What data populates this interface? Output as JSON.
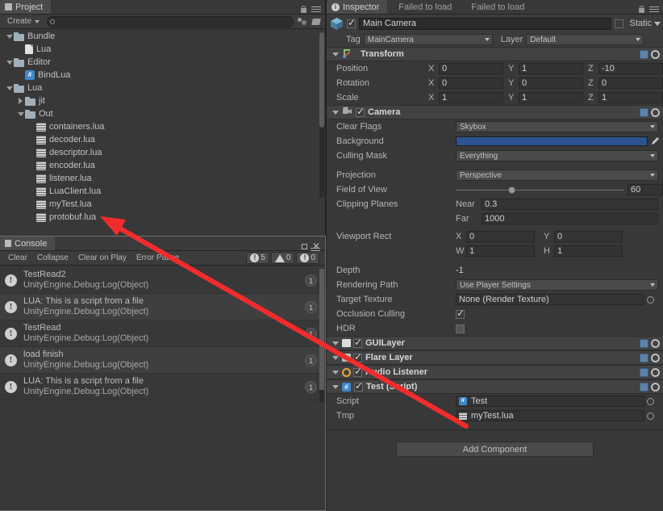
{
  "project": {
    "tab_label": "Project",
    "create_label": "Create",
    "search_placeholder": "",
    "icons": {
      "lock": "lock-icon",
      "menu": "hamburger-menu-icon",
      "favorite": "favorite-icon",
      "label": "label-icon",
      "search": "search-icon"
    },
    "tree": [
      {
        "label": "Bundle",
        "indent": 0,
        "twisty": "down",
        "icon": "folder"
      },
      {
        "label": "Lua",
        "indent": 1,
        "twisty": "none",
        "icon": "doc"
      },
      {
        "label": "Editor",
        "indent": 0,
        "twisty": "down",
        "icon": "folder"
      },
      {
        "label": "BindLua",
        "indent": 1,
        "twisty": "none",
        "icon": "script"
      },
      {
        "label": "Lua",
        "indent": 0,
        "twisty": "down",
        "icon": "folder"
      },
      {
        "label": "jit",
        "indent": 1,
        "twisty": "right",
        "icon": "folder"
      },
      {
        "label": "Out",
        "indent": 1,
        "twisty": "down",
        "icon": "folder"
      },
      {
        "label": "containers.lua",
        "indent": 2,
        "twisty": "none",
        "icon": "lua"
      },
      {
        "label": "decoder.lua",
        "indent": 2,
        "twisty": "none",
        "icon": "lua"
      },
      {
        "label": "descriptor.lua",
        "indent": 2,
        "twisty": "none",
        "icon": "lua"
      },
      {
        "label": "encoder.lua",
        "indent": 2,
        "twisty": "none",
        "icon": "lua"
      },
      {
        "label": "listener.lua",
        "indent": 2,
        "twisty": "none",
        "icon": "lua"
      },
      {
        "label": "LuaClient.lua",
        "indent": 2,
        "twisty": "none",
        "icon": "lua"
      },
      {
        "label": "myTest.lua",
        "indent": 2,
        "twisty": "none",
        "icon": "lua"
      },
      {
        "label": "protobuf.lua",
        "indent": 2,
        "twisty": "none",
        "icon": "lua"
      }
    ]
  },
  "console": {
    "tab_label": "Console",
    "buttons": [
      "Clear",
      "Collapse",
      "Clear on Play",
      "Error Pause"
    ],
    "counts": {
      "info": "5",
      "warning": "0",
      "error": "0"
    },
    "window_buttons": {
      "maximize": "maximize-icon",
      "close": "close-icon",
      "menu": "hamburger-menu-icon"
    },
    "entries": [
      {
        "message": "TestRead2",
        "stack": "UnityEngine.Debug:Log(Object)",
        "count": "1"
      },
      {
        "message": "LUA: This is a script from a file",
        "stack": "UnityEngine.Debug:Log(Object)",
        "count": "1"
      },
      {
        "message": "TestRead",
        "stack": "UnityEngine.Debug:Log(Object)",
        "count": "1"
      },
      {
        "message": "load finish",
        "stack": "UnityEngine.Debug:Log(Object)",
        "count": "1"
      },
      {
        "message": "LUA: This is a script from a file",
        "stack": "UnityEngine.Debug:Log(Object)",
        "count": "1"
      }
    ]
  },
  "inspector": {
    "tabs": [
      {
        "label": "Inspector",
        "active": true
      },
      {
        "label": "Failed to load",
        "active": false
      },
      {
        "label": "Failed to load",
        "active": false
      }
    ],
    "game_object": {
      "name": "Main Camera",
      "enabled": true,
      "static_label": "Static",
      "tag_label": "Tag",
      "tag_value": "MainCamera",
      "layer_label": "Layer",
      "layer_value": "Default"
    },
    "transform": {
      "title": "Transform",
      "rows": [
        {
          "label": "Position",
          "x": "0",
          "y": "1",
          "z": "-10"
        },
        {
          "label": "Rotation",
          "x": "0",
          "y": "0",
          "z": "0"
        },
        {
          "label": "Scale",
          "x": "1",
          "y": "1",
          "z": "1"
        }
      ]
    },
    "camera": {
      "title": "Camera",
      "enabled": true,
      "clear_flags_label": "Clear Flags",
      "clear_flags_value": "Skybox",
      "background_label": "Background",
      "background_color": "#2c5291",
      "culling_mask_label": "Culling Mask",
      "culling_mask_value": "Everything",
      "projection_label": "Projection",
      "projection_value": "Perspective",
      "fov_label": "Field of View",
      "fov_value": "60",
      "clipping_label": "Clipping Planes",
      "near_label": "Near",
      "near_value": "0.3",
      "far_label": "Far",
      "far_value": "1000",
      "viewport_label": "Viewport Rect",
      "viewport_x": "0",
      "viewport_y": "0",
      "viewport_w": "1",
      "viewport_h": "1",
      "depth_label": "Depth",
      "depth_value": "-1",
      "rendering_path_label": "Rendering Path",
      "rendering_path_value": "Use Player Settings",
      "target_texture_label": "Target Texture",
      "target_texture_value": "None (Render Texture)",
      "occlusion_label": "Occlusion Culling",
      "occlusion_value": true,
      "hdr_label": "HDR",
      "hdr_value": false
    },
    "components": [
      {
        "title": "GUILayer",
        "enabled": true,
        "icon": "gui-layer-icon"
      },
      {
        "title": "Flare Layer",
        "enabled": true,
        "icon": "flare-layer-icon"
      },
      {
        "title": "Audio Listener",
        "enabled": true,
        "icon": "audio-listener-icon"
      }
    ],
    "test_script": {
      "title": "Test (Script)",
      "enabled": true,
      "script_label": "Script",
      "script_value": "Test",
      "tmp_label": "Tmp",
      "tmp_value": "myTest.lua"
    },
    "add_component_label": "Add Component"
  },
  "annotation": {
    "arrow_color": "#f22c2c"
  }
}
